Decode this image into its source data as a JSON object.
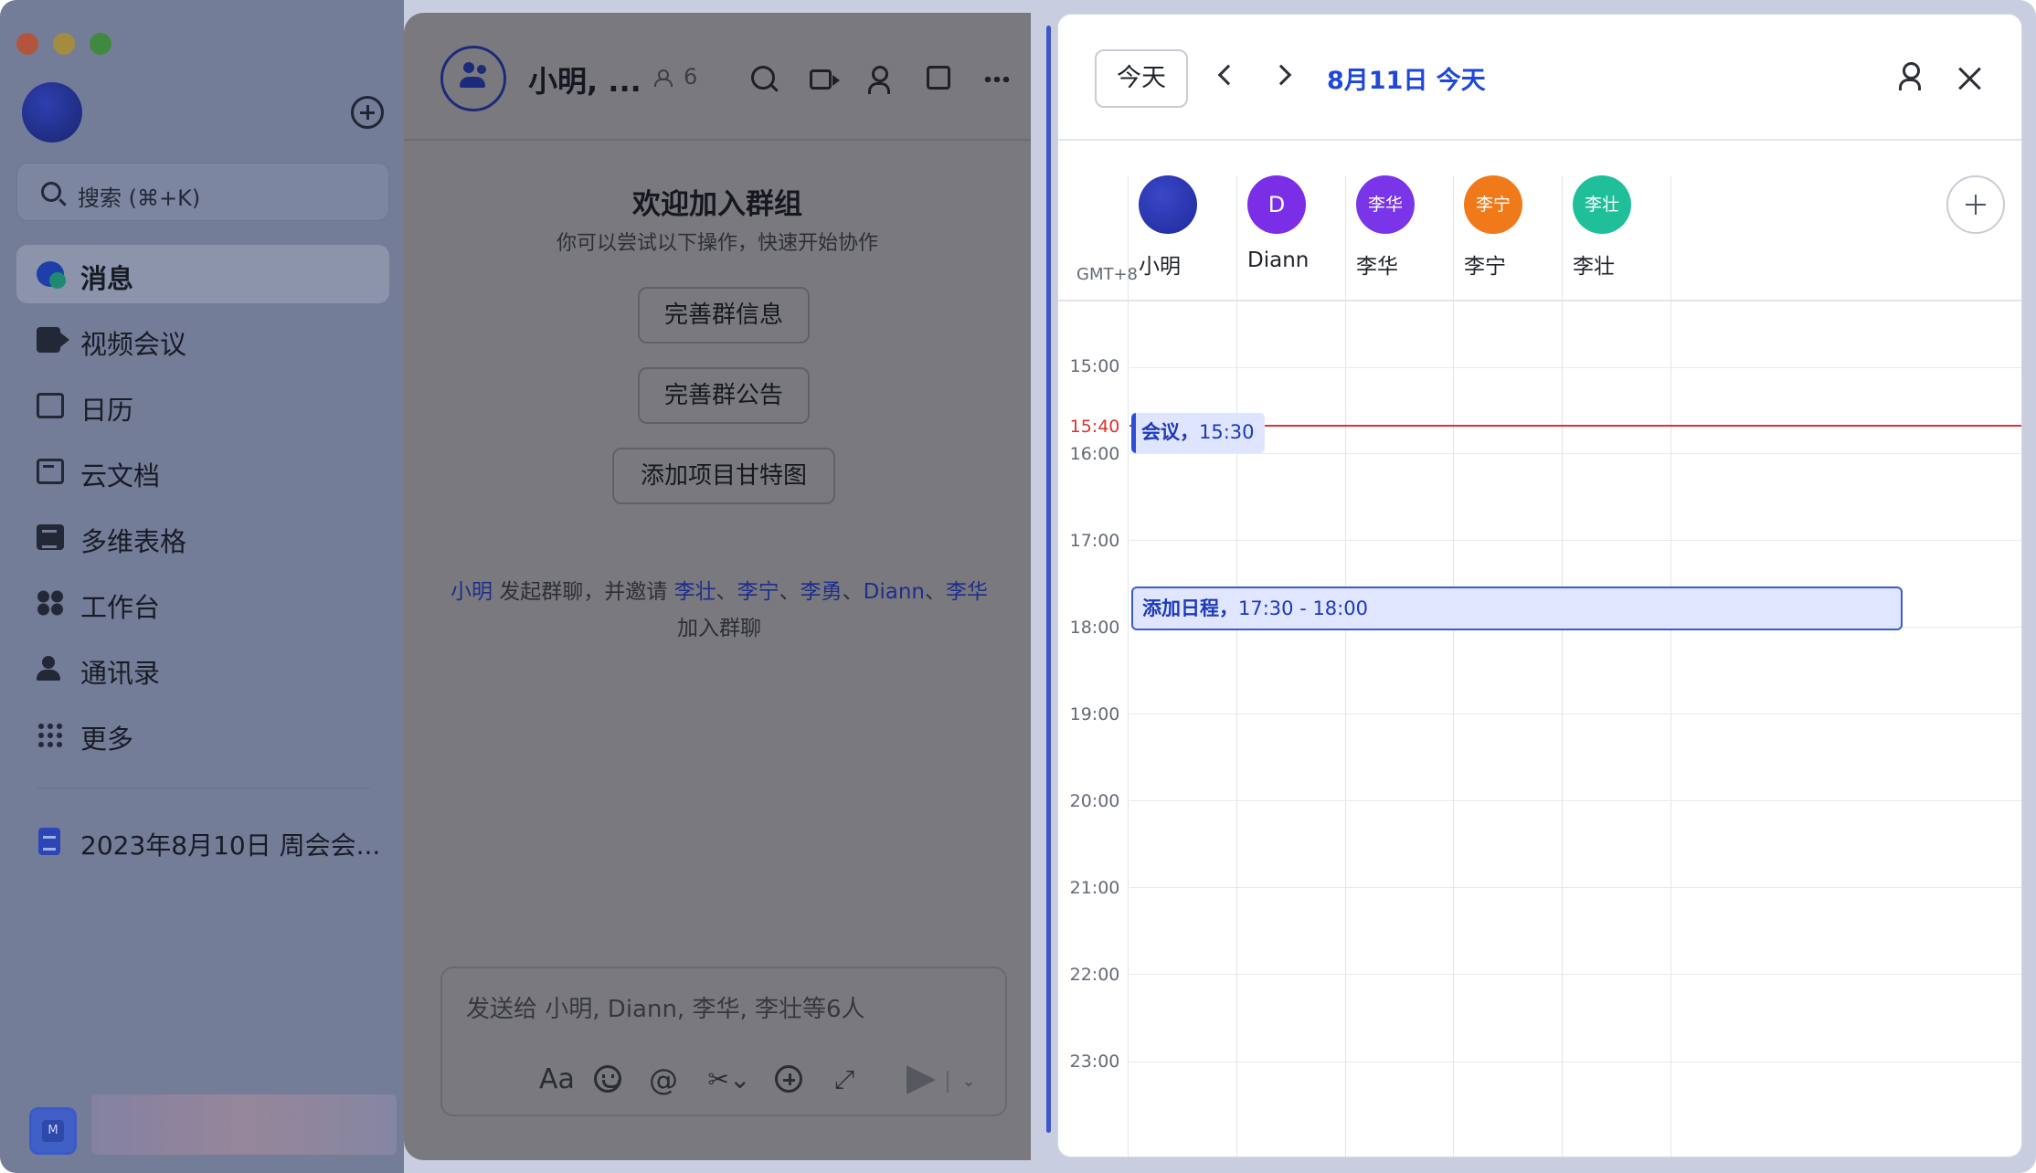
{
  "sidebar": {
    "search_placeholder": "搜索 (⌘+K)",
    "items": [
      {
        "label": "消息",
        "icon": "message-icon",
        "active": true
      },
      {
        "label": "视频会议",
        "icon": "video-icon"
      },
      {
        "label": "日历",
        "icon": "calendar-icon"
      },
      {
        "label": "云文档",
        "icon": "cloud-doc-icon"
      },
      {
        "label": "多维表格",
        "icon": "base-table-icon"
      },
      {
        "label": "工作台",
        "icon": "workplace-icon"
      },
      {
        "label": "通讯录",
        "icon": "contacts-icon"
      },
      {
        "label": "更多",
        "icon": "more-apps-icon"
      }
    ],
    "pinned_doc": "2023年8月10日 周会会...",
    "bottom_app_badge": "M"
  },
  "chat": {
    "title": "小明, ...",
    "member_count": "6",
    "welcome_title": "欢迎加入群组",
    "welcome_subtitle": "你可以尝试以下操作，快速开始协作",
    "quick_actions": [
      "完善群信息",
      "完善群公告",
      "添加项目甘特图"
    ],
    "system_message": {
      "initiator": "小明",
      "text_before": " 发起群聊，并邀请 ",
      "invitees": [
        "李壮",
        "李宁",
        "李勇",
        "Diann",
        "李华"
      ],
      "separator": "、",
      "text_after": " 加入群聊"
    },
    "composer_placeholder": "发送给 小明, Diann, 李华, 李壮等6人",
    "tools": {
      "font": "Aa",
      "at": "@",
      "cut": "✂⌄",
      "expand": "⤢",
      "caret": "⌄"
    }
  },
  "calendar": {
    "today_button": "今天",
    "date_label": "8月11日 今天",
    "timezone": "GMT+8",
    "attendees": [
      {
        "name": "小明",
        "avatar_text": "",
        "color": "#2a35b8"
      },
      {
        "name": "Diann",
        "avatar_text": "D",
        "color": "#7a2ee6"
      },
      {
        "name": "李华",
        "avatar_text": "李华",
        "color": "#7a35e8"
      },
      {
        "name": "李宁",
        "avatar_text": "李宁",
        "color": "#f07a1a"
      },
      {
        "name": "李壮",
        "avatar_text": "李壮",
        "color": "#1fbf9a"
      }
    ],
    "hours": [
      "15:00",
      "16:00",
      "17:00",
      "18:00",
      "19:00",
      "20:00",
      "21:00",
      "22:00",
      "23:00"
    ],
    "now_time": "15:40",
    "events": {
      "meeting": {
        "title": "会议，",
        "time": "15:30"
      },
      "add_schedule": {
        "title": "添加日程，",
        "time": "17:30 - 18:00"
      }
    }
  }
}
